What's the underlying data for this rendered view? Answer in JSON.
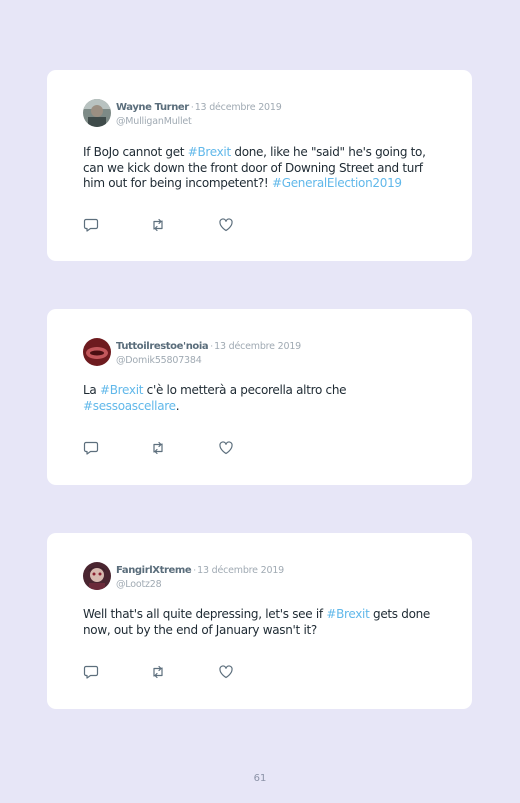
{
  "tweets": [
    {
      "name": "Wayne Turner",
      "date": "13 décembre 2019",
      "handle": "@MulliganMullet",
      "segments": [
        {
          "t": "If BoJo cannot get "
        },
        {
          "t": "#Brexit",
          "tag": true
        },
        {
          "t": " done, like he \"said\" he's going to, can we kick down the front door of Downing Street and turf him out for being incompetent?! "
        },
        {
          "t": "#GeneralElection2019",
          "tag": true
        }
      ]
    },
    {
      "name": "Tuttoilrestoe'noia",
      "date": "13 décembre 2019",
      "handle": "@Domik55807384",
      "segments": [
        {
          "t": "La "
        },
        {
          "t": "#Brexit",
          "tag": true
        },
        {
          "t": " c'è lo metterà a pecorella altro che "
        },
        {
          "t": "#sessoascellare",
          "tag": true
        },
        {
          "t": "."
        }
      ]
    },
    {
      "name": "FangirlXtreme",
      "date": "13 décembre 2019",
      "handle": "@Lootz28",
      "segments": [
        {
          "t": "Well that's all quite depressing, let's see if "
        },
        {
          "t": "#Brexit",
          "tag": true
        },
        {
          "t": " gets done now, out by the end of January wasn't it?"
        }
      ]
    }
  ],
  "separator": "·",
  "page_number": "61",
  "icons": [
    "reply-icon",
    "retweet-icon",
    "like-icon"
  ],
  "colors": {
    "background": "#e7e6f7",
    "hashtag": "#61b8ea",
    "name": "#5a6d7b",
    "meta": "#a0aab3",
    "icon": "#5d6f7d"
  }
}
